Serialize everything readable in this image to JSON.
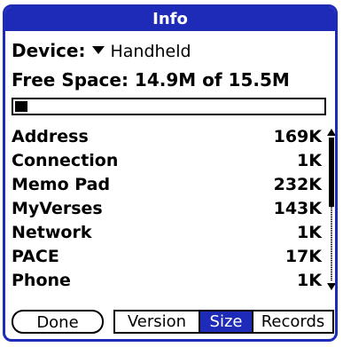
{
  "title": "Info",
  "device": {
    "label": "Device:",
    "value": "Handheld"
  },
  "free_space": {
    "text": "Free Space: 14.9M of 15.5M",
    "used_fraction": 0.04
  },
  "apps": [
    {
      "name": "Address",
      "size": "169K"
    },
    {
      "name": "Connection",
      "size": "1K"
    },
    {
      "name": "Memo Pad",
      "size": "232K"
    },
    {
      "name": "MyVerses",
      "size": "143K"
    },
    {
      "name": "Network",
      "size": "1K"
    },
    {
      "name": "PACE",
      "size": "17K"
    },
    {
      "name": "Phone",
      "size": "1K"
    }
  ],
  "buttons": {
    "done": "Done",
    "version": "Version",
    "size": "Size",
    "records": "Records"
  },
  "selected_tab": "size",
  "colors": {
    "accent": "#1e2bb8"
  }
}
